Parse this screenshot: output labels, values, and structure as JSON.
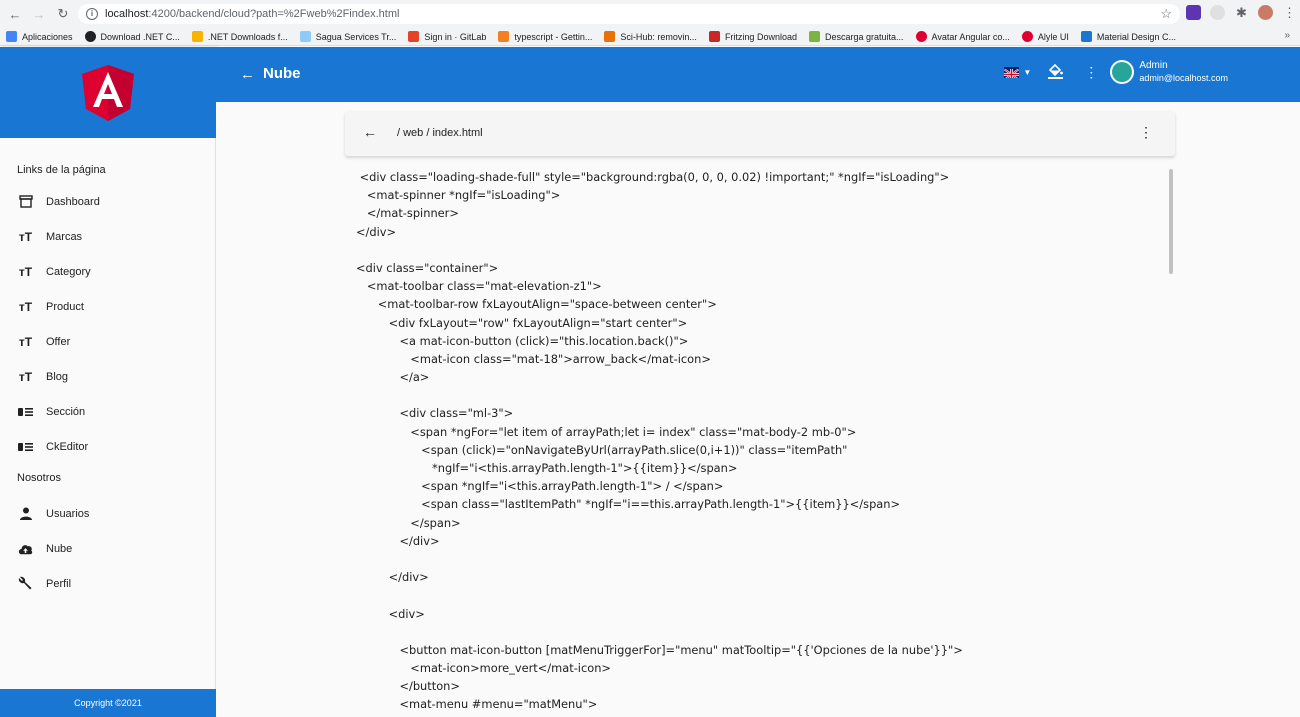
{
  "browser": {
    "url_host": "localhost",
    "url_path": ":4200/backend/cloud?path=%2Fweb%2Findex.html",
    "bookmarks": [
      {
        "label": "Aplicaciones",
        "color": "#4285f4"
      },
      {
        "label": "Download .NET C...",
        "color": "#202124"
      },
      {
        "label": ".NET Downloads f...",
        "color": "#f4b400"
      },
      {
        "label": "Sagua Services Tr...",
        "color": "#1a73e8"
      },
      {
        "label": "Sign in · GitLab",
        "color": "#e24329"
      },
      {
        "label": "typescript - Gettin...",
        "color": "#f48024"
      },
      {
        "label": "Sci-Hub: removin...",
        "color": "#e8710a"
      },
      {
        "label": "Fritzing Download",
        "color": "#c62828"
      },
      {
        "label": "Descarga gratuita...",
        "color": "#7cb342"
      },
      {
        "label": "Avatar Angular co...",
        "color": "#dd0031"
      },
      {
        "label": "Alyle UI",
        "color": "#dd0031"
      },
      {
        "label": "Material Design C...",
        "color": "#1976d2"
      }
    ],
    "more_label": "»"
  },
  "sidebar": {
    "section1": "Links de la página",
    "section2": "Nosotros",
    "items1": [
      {
        "label": "Dashboard",
        "icon": "store-icon"
      },
      {
        "label": "Marcas",
        "icon": "text-fields-icon"
      },
      {
        "label": "Category",
        "icon": "text-fields-icon"
      },
      {
        "label": "Product",
        "icon": "text-fields-icon"
      },
      {
        "label": "Offer",
        "icon": "text-fields-icon"
      },
      {
        "label": "Blog",
        "icon": "text-fields-icon"
      },
      {
        "label": "Sección",
        "icon": "view-list-icon"
      },
      {
        "label": "CkEditor",
        "icon": "view-list-icon"
      }
    ],
    "items2": [
      {
        "label": "Usuarios",
        "icon": "person-icon"
      },
      {
        "label": "Nube",
        "icon": "cloud-upload-icon"
      },
      {
        "label": "Perfil",
        "icon": "wrench-icon"
      }
    ],
    "footer": "Copyright ©2021"
  },
  "toolbar": {
    "title": "Nube",
    "user_name": "Admin",
    "user_email": "admin@localhost.com"
  },
  "file_bar": {
    "path": "/ web / index.html"
  },
  "code_lines": [
    " <div class=\"loading-shade-full\" style=\"background:rgba(0, 0, 0, 0.02) !important;\" *ngIf=\"isLoading\">",
    "   <mat-spinner *ngIf=\"isLoading\">",
    "   </mat-spinner>",
    "</div>",
    "",
    "<div class=\"container\">",
    "   <mat-toolbar class=\"mat-elevation-z1\">",
    "      <mat-toolbar-row fxLayoutAlign=\"space-between center\">",
    "         <div fxLayout=\"row\" fxLayoutAlign=\"start center\">",
    "            <a mat-icon-button (click)=\"this.location.back()\">",
    "               <mat-icon class=\"mat-18\">arrow_back</mat-icon>",
    "            </a>",
    "",
    "            <div class=\"ml-3\">",
    "               <span *ngFor=\"let item of arrayPath;let i= index\" class=\"mat-body-2 mb-0\">",
    "                  <span (click)=\"onNavigateByUrl(arrayPath.slice(0,i+1))\" class=\"itemPath\"",
    "                     *ngIf=\"i<this.arrayPath.length-1\">{{item}}</span>",
    "                  <span *ngIf=\"i<this.arrayPath.length-1\"> / </span>",
    "                  <span class=\"lastItemPath\" *ngIf=\"i==this.arrayPath.length-1\">{{item}}</span>",
    "               </span>",
    "            </div>",
    "",
    "         </div>",
    "",
    "         <div>",
    "",
    "            <button mat-icon-button [matMenuTriggerFor]=\"menu\" matTooltip=\"{{'Opciones de la nube'}}\">",
    "               <mat-icon>more_vert</mat-icon>",
    "            </button>",
    "            <mat-menu #menu=\"matMenu\">"
  ]
}
